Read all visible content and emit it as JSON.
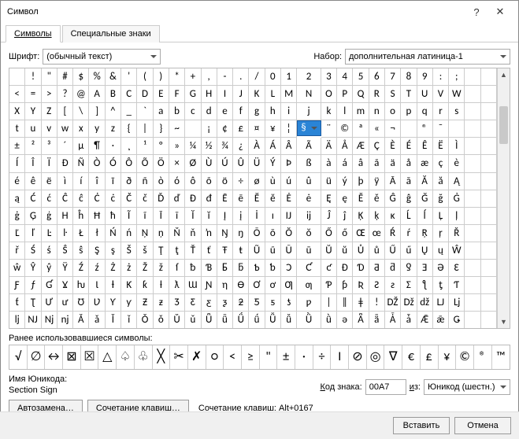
{
  "window": {
    "title": "Символ"
  },
  "tabs": {
    "symbols": "Символы",
    "special": "Специальные знаки"
  },
  "font": {
    "label": "Шрифт:",
    "value": "(обычный текст)"
  },
  "set": {
    "label": "Набор:",
    "value": "дополнительная латиница-1"
  },
  "grid": {
    "rows": [
      [
        " ",
        "!",
        "\"",
        "#",
        "$",
        "%",
        "&",
        "'",
        "(",
        ")",
        "*",
        "+",
        ",",
        "-",
        ".",
        "/",
        "0",
        "1",
        "2",
        "3",
        "4",
        "5",
        "6",
        "7",
        "8",
        "9",
        ":",
        ";"
      ],
      [
        "<",
        "=",
        ">",
        "?",
        "@",
        "A",
        "B",
        "C",
        "D",
        "E",
        "F",
        "G",
        "H",
        "I",
        "J",
        "K",
        "L",
        "M",
        "N",
        "O",
        "P",
        "Q",
        "R",
        "S",
        "T",
        "U",
        "V",
        "W"
      ],
      [
        "X",
        "Y",
        "Z",
        "[",
        "\\",
        "]",
        "^",
        "_",
        "`",
        "a",
        "b",
        "c",
        "d",
        "e",
        "f",
        "g",
        "h",
        "i",
        "j",
        "k",
        "l",
        "m",
        "n",
        "o",
        "p",
        "q",
        "r",
        "s"
      ],
      [
        "t",
        "u",
        "v",
        "w",
        "x",
        "y",
        "z",
        "{",
        "|",
        "}",
        "~",
        "",
        "¡",
        "¢",
        "£",
        "¤",
        "¥",
        "¦",
        "§",
        "¨",
        "©",
        "ª",
        "«",
        "¬",
        "­",
        "®",
        "¯"
      ],
      [
        "±",
        "²",
        "³",
        "´",
        "µ",
        "¶",
        "·",
        "¸",
        "¹",
        "º",
        "»",
        "¼",
        "½",
        "¾",
        "¿",
        "À",
        "Á",
        "Â",
        "Ã",
        "Ä",
        "Å",
        "Æ",
        "Ç",
        "È",
        "É",
        "Ê",
        "Ë",
        "Ì"
      ],
      [
        "Í",
        "Î",
        "Ï",
        "Ð",
        "Ñ",
        "Ò",
        "Ó",
        "Ô",
        "Õ",
        "Ö",
        "×",
        "Ø",
        "Ù",
        "Ú",
        "Û",
        "Ü",
        "Ý",
        "Þ",
        "ß",
        "à",
        "á",
        "â",
        "ã",
        "ä",
        "å",
        "æ",
        "ç",
        "è"
      ],
      [
        "é",
        "ê",
        "ë",
        "ì",
        "í",
        "î",
        "ï",
        "ð",
        "ñ",
        "ò",
        "ó",
        "ô",
        "õ",
        "ö",
        "÷",
        "ø",
        "ù",
        "ú",
        "û",
        "ü",
        "ý",
        "þ",
        "ÿ",
        "Ā",
        "ā",
        "Ă",
        "ă",
        "Ą"
      ],
      [
        "ą",
        "Ć",
        "ć",
        "Ĉ",
        "ĉ",
        "Ċ",
        "ċ",
        "Č",
        "č",
        "Ď",
        "ď",
        "Đ",
        "đ",
        "Ē",
        "ē",
        "Ĕ",
        "ĕ",
        "Ė",
        "ė",
        "Ę",
        "ę",
        "Ě",
        "ě",
        "Ĝ",
        "ĝ",
        "Ğ",
        "ğ",
        "Ġ"
      ],
      [
        "ġ",
        "Ģ",
        "ģ",
        "Ĥ",
        "ĥ",
        "Ħ",
        "ħ",
        "Ĩ",
        "ĩ",
        "Ī",
        "ī",
        "Ĭ",
        "ĭ",
        "Į",
        "į",
        "İ",
        "ı",
        "Ĳ",
        "ĳ",
        "Ĵ",
        "ĵ",
        "Ķ",
        "ķ",
        "ĸ",
        "Ĺ",
        "ĺ",
        "Ļ",
        "ļ"
      ],
      [
        "Ľ",
        "ľ",
        "Ŀ",
        "ŀ",
        "Ł",
        "ł",
        "Ń",
        "ń",
        "Ņ",
        "ņ",
        "Ň",
        "ň",
        "ŉ",
        "Ŋ",
        "ŋ",
        "Ō",
        "ō",
        "Ŏ",
        "ŏ",
        "Ő",
        "ő",
        "Œ",
        "œ",
        "Ŕ",
        "ŕ",
        "Ŗ",
        "ŗ",
        "Ř"
      ],
      [
        "ř",
        "Ś",
        "ś",
        "Ŝ",
        "ŝ",
        "Ş",
        "ş",
        "Š",
        "š",
        "Ţ",
        "ţ",
        "Ť",
        "ť",
        "Ŧ",
        "ŧ",
        "Ũ",
        "ũ",
        "Ū",
        "ū",
        "Ŭ",
        "ŭ",
        "Ů",
        "ů",
        "Ű",
        "ű",
        "Ų",
        "ų",
        "Ŵ"
      ],
      [
        "ŵ",
        "Ŷ",
        "ŷ",
        "Ÿ",
        "Ź",
        "ź",
        "Ż",
        "ż",
        "Ž",
        "ž",
        "ſ",
        "ƀ",
        "Ɓ",
        "Ƃ",
        "ƃ",
        "Ƅ",
        "ƅ",
        "Ɔ",
        "Ƈ",
        "ƈ",
        "Ɖ",
        "Ɗ",
        "Ƌ",
        "ƌ",
        "ƍ",
        "Ǝ",
        "Ə",
        "Ɛ"
      ],
      [
        "Ƒ",
        "ƒ",
        "Ɠ",
        "Ɣ",
        "ƕ",
        "Ɩ",
        "Ɨ",
        "Ƙ",
        "ƙ",
        "ƚ",
        "ƛ",
        "Ɯ",
        "Ɲ",
        "ƞ",
        "Ɵ",
        "Ơ",
        "ơ",
        "Ƣ",
        "ƣ",
        "Ƥ",
        "ƥ",
        "Ʀ",
        "Ƨ",
        "ƨ",
        "Ʃ",
        "ƪ",
        "ƫ",
        "Ƭ"
      ],
      [
        "ƭ",
        "Ʈ",
        "Ư",
        "ư",
        "Ʊ",
        "Ʋ",
        "Ƴ",
        "ƴ",
        "Ƶ",
        "ƶ",
        "Ʒ",
        "Ƹ",
        "ƹ",
        "ƺ",
        "ƻ",
        "Ƽ",
        "ƽ",
        "ƾ",
        "ƿ",
        "ǀ",
        "ǁ",
        "ǂ",
        "ǃ",
        "Ǆ",
        "ǅ",
        "ǆ",
        "Ǉ",
        "ǈ"
      ],
      [
        "ǉ",
        "Ǌ",
        "ǋ",
        "ǌ",
        "Ǎ",
        "ǎ",
        "Ǐ",
        "ǐ",
        "Ǒ",
        "ǒ",
        "Ǔ",
        "ǔ",
        "Ǖ",
        "ǖ",
        "Ǘ",
        "ǘ",
        "Ǚ",
        "ǚ",
        "Ǜ",
        "ǜ",
        "ǝ",
        "Ǟ",
        "ǟ",
        "Ǡ",
        "ǡ",
        "Ǣ",
        "ǣ",
        "Ǥ"
      ]
    ],
    "selected": {
      "row": 3,
      "col": 18
    }
  },
  "recent": {
    "label": "Ранее использовавшиеся символы:",
    "items": [
      "√",
      "∅",
      "↔",
      "⊠",
      "☒",
      "△",
      "♤",
      "♧",
      "╳",
      "✂",
      "✗",
      "○",
      "<",
      "≥",
      "\"",
      "±",
      "·",
      "÷",
      "I",
      "⊘",
      "◎",
      "∇",
      "€",
      "£",
      "¥",
      "©",
      "®",
      "™"
    ]
  },
  "unicode": {
    "name_label": "Имя Юникода:",
    "name_value": "Section Sign",
    "code_label": "Код знака:",
    "code_value": "00A7",
    "from_label": "из:",
    "from_value": "Юникод (шестн.)"
  },
  "buttons": {
    "autocorrect": "Автозамена…",
    "shortcut": "Сочетание клавиш…",
    "shortcut_label": "Сочетание клавиш: Alt+0167",
    "insert": "Вставить",
    "cancel": "Отмена"
  }
}
